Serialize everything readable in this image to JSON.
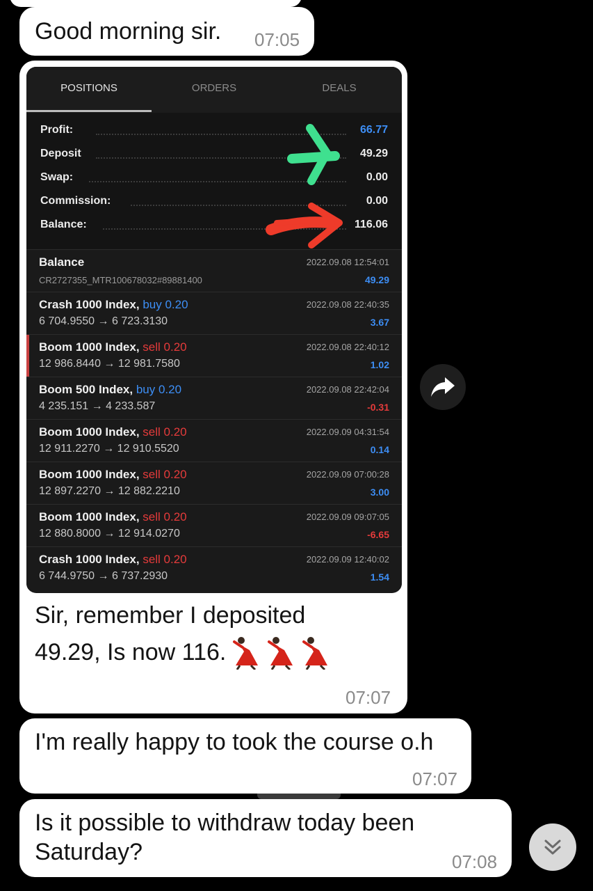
{
  "messages": [
    {
      "text": "Good morning sir.",
      "time": "07:05"
    },
    {
      "caption_line1": "Sir, remember I deposited",
      "caption_line2": "49.29, Is now 116.",
      "time": "07:07"
    },
    {
      "text": "I'm really happy to took the course o.h",
      "time": "07:07"
    },
    {
      "line1": "Is it possible to withdraw today been",
      "line2": "Saturday?",
      "time": "07:08"
    }
  ],
  "emoji": "dancer-emoji",
  "screenshot": {
    "tabs": [
      "POSITIONS",
      "ORDERS",
      "DEALS"
    ],
    "active_tab": "POSITIONS",
    "summary": [
      {
        "label": "Profit:",
        "value": "66.77"
      },
      {
        "label": "Deposit",
        "value": "49.29"
      },
      {
        "label": "Swap:",
        "value": "0.00"
      },
      {
        "label": "Commission:",
        "value": "0.00"
      },
      {
        "label": "Balance:",
        "value": "116.06"
      }
    ],
    "deals": [
      {
        "symbol": "Balance",
        "type": "",
        "sub": "CR2727355_MTR100678032#89881400",
        "date": "2022.09.08 12:54:01",
        "value": "49.29"
      },
      {
        "symbol": "Crash 1000 Index,",
        "type": "buy 0.20",
        "sub": "6 704.9550 → 6 723.3130",
        "date": "2022.09.08 22:40:35",
        "value": "3.67"
      },
      {
        "symbol": "Boom 1000 Index,",
        "type": "sell 0.20",
        "sub": "12 986.8440 → 12 981.7580",
        "date": "2022.09.08 22:40:12",
        "value": "1.02"
      },
      {
        "symbol": "Boom 500 Index,",
        "type": "buy 0.20",
        "sub": "4 235.151 → 4 233.587",
        "date": "2022.09.08 22:42:04",
        "value": "-0.31"
      },
      {
        "symbol": "Boom 1000 Index,",
        "type": "sell 0.20",
        "sub": "12 911.2270 → 12 910.5520",
        "date": "2022.09.09 04:31:54",
        "value": "0.14"
      },
      {
        "symbol": "Boom 1000 Index,",
        "type": "sell 0.20",
        "sub": "12 897.2270 → 12 882.2210",
        "date": "2022.09.09 07:00:28",
        "value": "3.00"
      },
      {
        "symbol": "Boom 1000 Index,",
        "type": "sell 0.20",
        "sub": "12 880.8000 → 12 914.0270",
        "date": "2022.09.09 09:07:05",
        "value": "-6.65"
      },
      {
        "symbol": "Crash 1000 Index,",
        "type": "sell 0.20",
        "sub": "6 744.9750 → 6 737.2930",
        "date": "2022.09.09 12:40:02",
        "value": "1.54"
      }
    ]
  },
  "colors": {
    "buy": "#3d8ef5",
    "sell": "#e53b3b",
    "green_arrow": "#3fe08f",
    "red_arrow": "#ee3b2a"
  },
  "icons": {
    "share": "share-icon",
    "scroll_down": "chevron-double-down-icon"
  }
}
